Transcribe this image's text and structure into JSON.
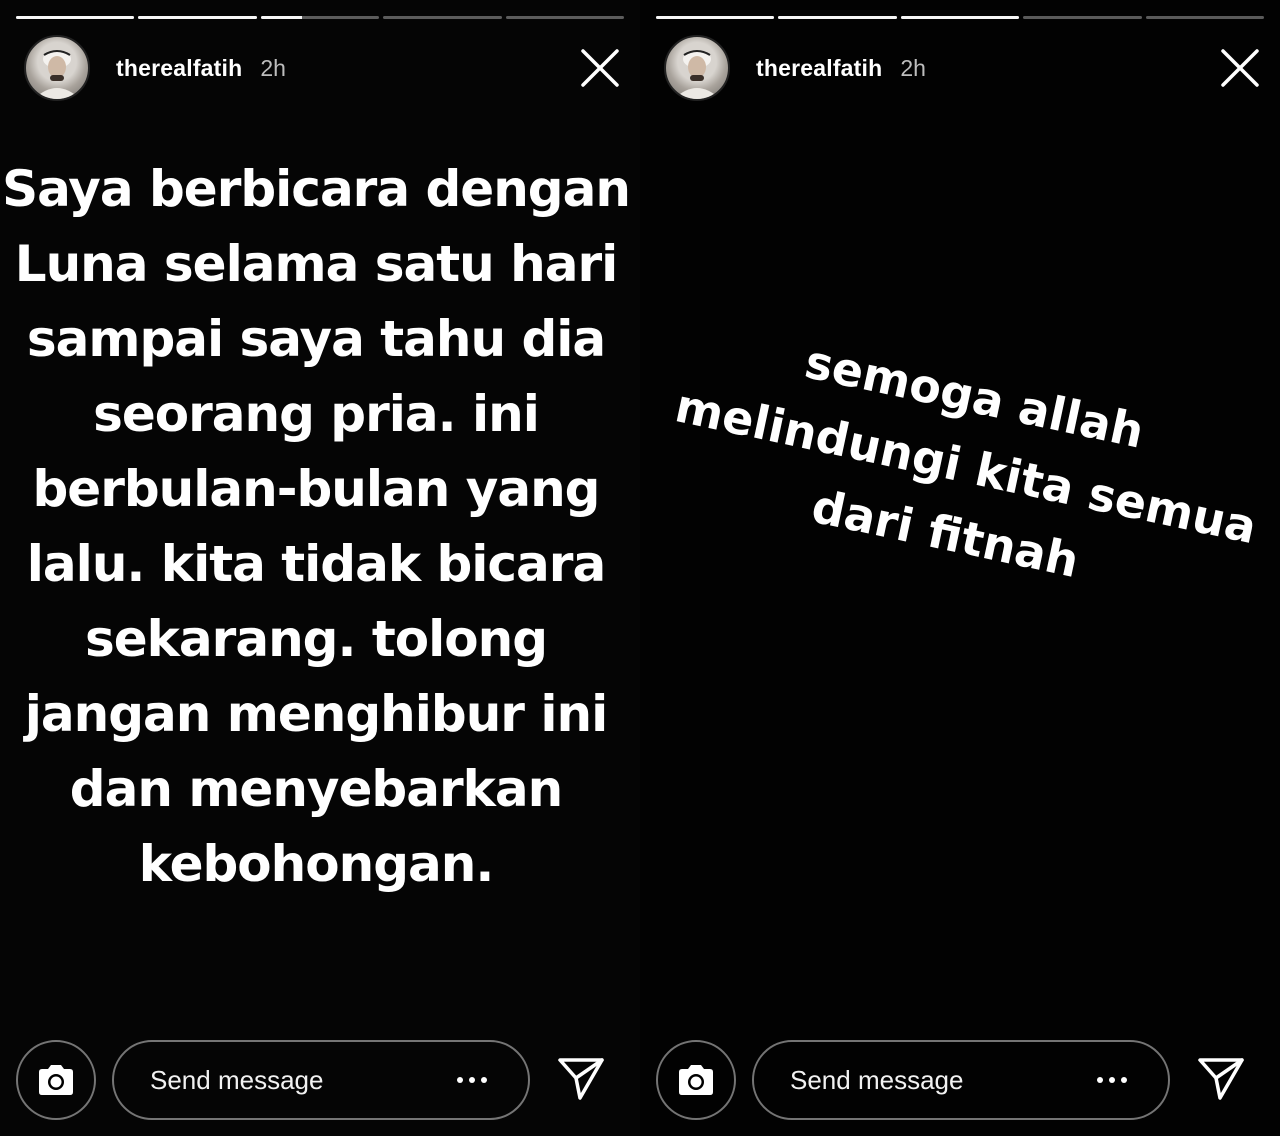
{
  "stories": [
    {
      "progress": [
        1,
        1,
        0.35,
        0,
        0
      ],
      "user": {
        "username": "therealfatih",
        "time": "2h"
      },
      "text_lines": [
        "Saya berbicara dengan",
        "Luna selama satu hari",
        "sampai saya tahu dia",
        "seorang pria. ini",
        "berbulan-bulan yang",
        "lalu. kita tidak bicara",
        "sekarang. tolong",
        "jangan menghibur ini",
        "dan menyebarkan",
        "kebohongan."
      ],
      "footer": {
        "message_placeholder": "Send message"
      }
    },
    {
      "progress": [
        1,
        1,
        1,
        0,
        0
      ],
      "user": {
        "username": "therealfatih",
        "time": "2h"
      },
      "text_lines": [
        "semoga allah",
        "melindungi kita semua",
        "dari fitnah"
      ],
      "footer": {
        "message_placeholder": "Send message"
      }
    }
  ],
  "icons": {
    "camera": "camera-icon",
    "close": "close-icon",
    "more": "more-dots-icon",
    "send": "send-icon"
  },
  "colors": {
    "background": "#000000",
    "text": "#ffffff",
    "muted": "#bdbdbd"
  }
}
